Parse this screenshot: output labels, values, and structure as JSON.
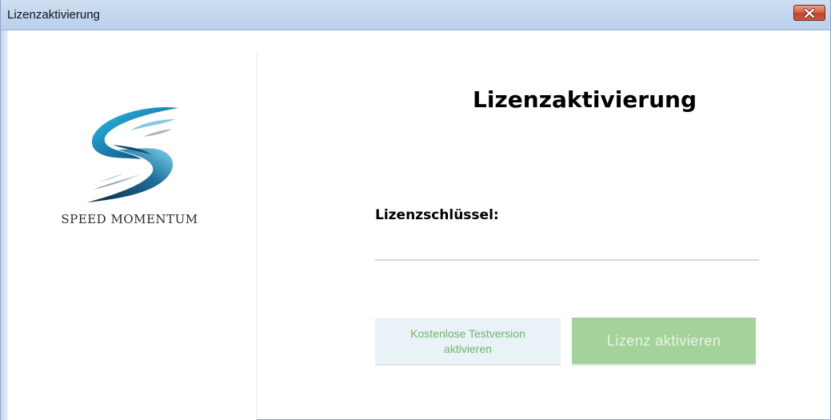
{
  "window": {
    "title": "Lizenzaktivierung",
    "close_icon": "close-icon",
    "close_color": "#c9432c"
  },
  "brand": {
    "logo_icon": "speed-momentum-logo-icon",
    "name": "SPEED MOMENTUM"
  },
  "main": {
    "heading": "Lizenzaktivierung",
    "license_label": "Lizenzschlüssel:",
    "license_value": "",
    "trial_button": "Kostenlose Testversion aktivieren",
    "activate_button": "Lizenz aktivieren"
  },
  "colors": {
    "titlebar": "#c3d6ee",
    "trial_bg": "#e9f2f7",
    "trial_text": "#6fb36f",
    "activate_bg": "#a3d39a"
  }
}
